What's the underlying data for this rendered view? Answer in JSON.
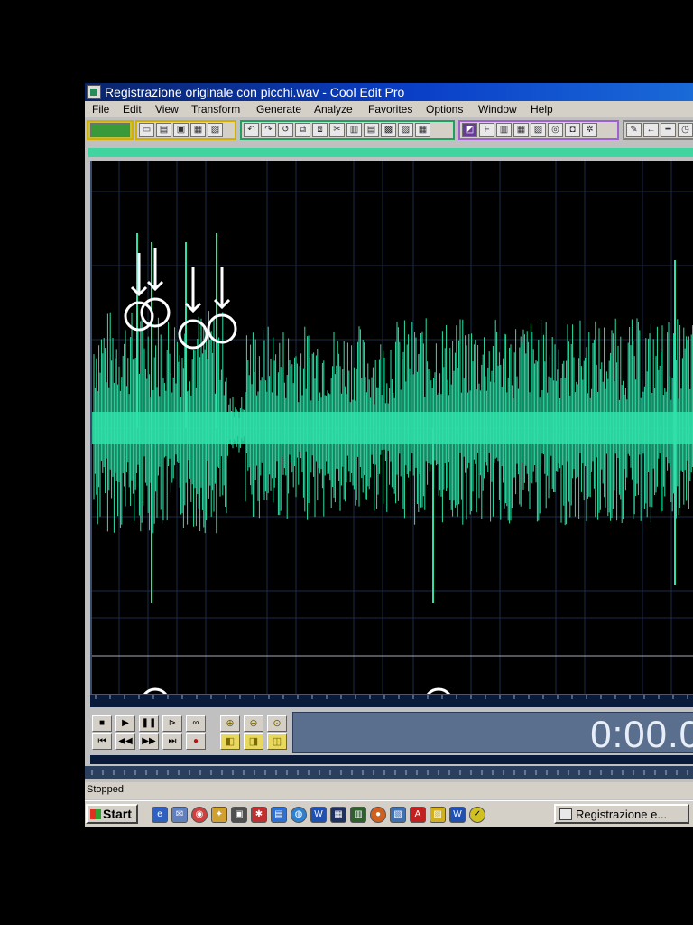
{
  "window": {
    "title": "Registrazione originale con picchi.wav - Cool Edit Pro"
  },
  "menu": [
    "File",
    "Edit",
    "View",
    "Transform",
    "Generate",
    "Analyze",
    "Favorites",
    "Options",
    "Window",
    "Help"
  ],
  "transport": {
    "time": "0:00.0"
  },
  "status": {
    "text": "Stopped"
  },
  "taskbar": {
    "start_label": "Start",
    "task_label": "Registrazione e..."
  },
  "colors": {
    "waveform": "#2fe0a8",
    "title_bar": "#0a246a",
    "background": "#000000",
    "annotation": "#ffffff"
  },
  "annotations": {
    "upper_peaks_marked": 4,
    "lower_peaks_marked": 2
  }
}
